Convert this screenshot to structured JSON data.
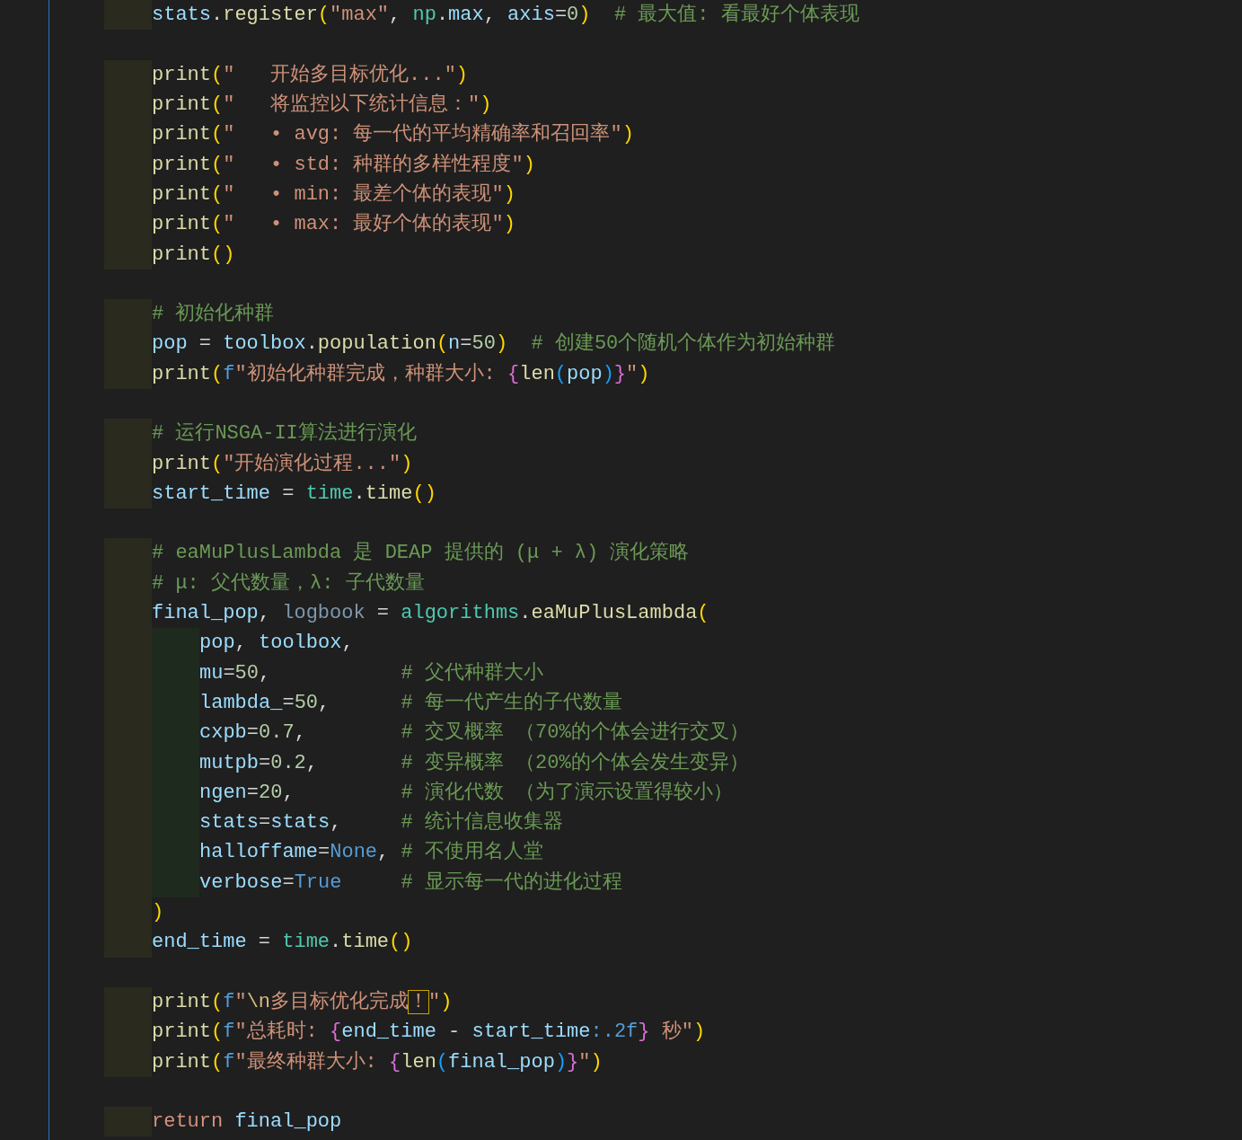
{
  "editor": {
    "lines": [
      {
        "kind": "code",
        "tokens": [
          {
            "kind": "var",
            "text": "stats"
          },
          {
            "kind": "plain",
            "text": "."
          },
          {
            "kind": "func",
            "text": "register"
          },
          {
            "kind": "bracket1",
            "text": "("
          },
          {
            "kind": "string",
            "text": "\"max\""
          },
          {
            "kind": "plain",
            "text": ", "
          },
          {
            "kind": "module",
            "text": "np"
          },
          {
            "kind": "plain",
            "text": "."
          },
          {
            "kind": "var",
            "text": "max"
          },
          {
            "kind": "plain",
            "text": ", "
          },
          {
            "kind": "var",
            "text": "axis"
          },
          {
            "kind": "plain",
            "text": "="
          },
          {
            "kind": "number",
            "text": "0"
          },
          {
            "kind": "bracket1",
            "text": ")"
          },
          {
            "kind": "comment",
            "text": "  # 最大值: 看最好个体表现"
          }
        ]
      },
      {
        "kind": "blank"
      },
      {
        "kind": "code",
        "tokens": [
          {
            "kind": "func",
            "text": "print"
          },
          {
            "kind": "bracket1",
            "text": "("
          },
          {
            "kind": "string",
            "text": "\"   开始多目标优化...\""
          },
          {
            "kind": "bracket1",
            "text": ")"
          }
        ]
      },
      {
        "kind": "code",
        "tokens": [
          {
            "kind": "func",
            "text": "print"
          },
          {
            "kind": "bracket1",
            "text": "("
          },
          {
            "kind": "string",
            "text": "\"   将监控以下统计信息：\""
          },
          {
            "kind": "bracket1",
            "text": ")"
          }
        ]
      },
      {
        "kind": "code",
        "tokens": [
          {
            "kind": "func",
            "text": "print"
          },
          {
            "kind": "bracket1",
            "text": "("
          },
          {
            "kind": "string",
            "text": "\"   • avg: 每一代的平均精确率和召回率\""
          },
          {
            "kind": "bracket1",
            "text": ")"
          }
        ]
      },
      {
        "kind": "code",
        "tokens": [
          {
            "kind": "func",
            "text": "print"
          },
          {
            "kind": "bracket1",
            "text": "("
          },
          {
            "kind": "string",
            "text": "\"   • std: 种群的多样性程度\""
          },
          {
            "kind": "bracket1",
            "text": ")"
          }
        ]
      },
      {
        "kind": "code",
        "tokens": [
          {
            "kind": "func",
            "text": "print"
          },
          {
            "kind": "bracket1",
            "text": "("
          },
          {
            "kind": "string",
            "text": "\"   • min: 最差个体的表现\""
          },
          {
            "kind": "bracket1",
            "text": ")"
          }
        ]
      },
      {
        "kind": "code",
        "tokens": [
          {
            "kind": "func",
            "text": "print"
          },
          {
            "kind": "bracket1",
            "text": "("
          },
          {
            "kind": "string",
            "text": "\"   • max: 最好个体的表现\""
          },
          {
            "kind": "bracket1",
            "text": ")"
          }
        ]
      },
      {
        "kind": "code",
        "tokens": [
          {
            "kind": "func",
            "text": "print"
          },
          {
            "kind": "bracket1",
            "text": "("
          },
          {
            "kind": "bracket1",
            "text": ")"
          }
        ]
      },
      {
        "kind": "blank"
      },
      {
        "kind": "code",
        "tokens": [
          {
            "kind": "comment",
            "text": "# 初始化种群"
          }
        ]
      },
      {
        "kind": "code",
        "tokens": [
          {
            "kind": "var",
            "text": "pop"
          },
          {
            "kind": "plain",
            "text": " = "
          },
          {
            "kind": "var",
            "text": "toolbox"
          },
          {
            "kind": "plain",
            "text": "."
          },
          {
            "kind": "func",
            "text": "population"
          },
          {
            "kind": "bracket1",
            "text": "("
          },
          {
            "kind": "var",
            "text": "n"
          },
          {
            "kind": "plain",
            "text": "="
          },
          {
            "kind": "number",
            "text": "50"
          },
          {
            "kind": "bracket1",
            "text": ")"
          },
          {
            "kind": "comment",
            "text": "  # 创建50个随机个体作为初始种群"
          }
        ]
      },
      {
        "kind": "code",
        "tokens": [
          {
            "kind": "func",
            "text": "print"
          },
          {
            "kind": "bracket1",
            "text": "("
          },
          {
            "kind": "keyword",
            "text": "f"
          },
          {
            "kind": "string",
            "text": "\"初始化种群完成，种群大小: "
          },
          {
            "kind": "bracket2",
            "text": "{"
          },
          {
            "kind": "func",
            "text": "len"
          },
          {
            "kind": "bracket3",
            "text": "("
          },
          {
            "kind": "var",
            "text": "pop"
          },
          {
            "kind": "bracket3",
            "text": ")"
          },
          {
            "kind": "bracket2",
            "text": "}"
          },
          {
            "kind": "string",
            "text": "\""
          },
          {
            "kind": "bracket1",
            "text": ")"
          }
        ]
      },
      {
        "kind": "blank"
      },
      {
        "kind": "code",
        "tokens": [
          {
            "kind": "comment",
            "text": "# 运行NSGA-II算法进行演化"
          }
        ]
      },
      {
        "kind": "code",
        "tokens": [
          {
            "kind": "func",
            "text": "print"
          },
          {
            "kind": "bracket1",
            "text": "("
          },
          {
            "kind": "string",
            "text": "\"开始演化过程...\""
          },
          {
            "kind": "bracket1",
            "text": ")"
          }
        ]
      },
      {
        "kind": "code",
        "tokens": [
          {
            "kind": "var",
            "text": "start_time"
          },
          {
            "kind": "plain",
            "text": " = "
          },
          {
            "kind": "module",
            "text": "time"
          },
          {
            "kind": "plain",
            "text": "."
          },
          {
            "kind": "func",
            "text": "time"
          },
          {
            "kind": "bracket1",
            "text": "("
          },
          {
            "kind": "bracket1",
            "text": ")"
          }
        ]
      },
      {
        "kind": "blank"
      },
      {
        "kind": "code",
        "tokens": [
          {
            "kind": "comment",
            "text": "# eaMuPlusLambda 是 DEAP 提供的 (μ + λ) 演化策略"
          }
        ]
      },
      {
        "kind": "code",
        "tokens": [
          {
            "kind": "comment",
            "text": "# μ: 父代数量，λ: 子代数量"
          }
        ]
      },
      {
        "kind": "code",
        "tokens": [
          {
            "kind": "var",
            "text": "final_pop"
          },
          {
            "kind": "plain",
            "text": ", "
          },
          {
            "kind": "unused",
            "text": "logbook"
          },
          {
            "kind": "plain",
            "text": " = "
          },
          {
            "kind": "module",
            "text": "algorithms"
          },
          {
            "kind": "plain",
            "text": "."
          },
          {
            "kind": "func",
            "text": "eaMuPlusLambda"
          },
          {
            "kind": "bracket1",
            "text": "("
          }
        ],
        "children": [
          {
            "kind": "code",
            "tokens": [
              {
                "kind": "var",
                "text": "pop"
              },
              {
                "kind": "plain",
                "text": ", "
              },
              {
                "kind": "var",
                "text": "toolbox"
              },
              {
                "kind": "plain",
                "text": ","
              }
            ]
          },
          {
            "kind": "code",
            "tokens": [
              {
                "kind": "var",
                "text": "mu"
              },
              {
                "kind": "plain",
                "text": "="
              },
              {
                "kind": "number",
                "text": "50"
              },
              {
                "kind": "plain",
                "text": ",           "
              },
              {
                "kind": "comment",
                "text": "# 父代种群大小"
              }
            ]
          },
          {
            "kind": "code",
            "tokens": [
              {
                "kind": "var",
                "text": "lambda_"
              },
              {
                "kind": "plain",
                "text": "="
              },
              {
                "kind": "number",
                "text": "50"
              },
              {
                "kind": "plain",
                "text": ",      "
              },
              {
                "kind": "comment",
                "text": "# 每一代产生的子代数量"
              }
            ]
          },
          {
            "kind": "code",
            "tokens": [
              {
                "kind": "var",
                "text": "cxpb"
              },
              {
                "kind": "plain",
                "text": "="
              },
              {
                "kind": "number",
                "text": "0.7"
              },
              {
                "kind": "plain",
                "text": ",        "
              },
              {
                "kind": "comment",
                "text": "# 交叉概率 （70%的个体会进行交叉）"
              }
            ]
          },
          {
            "kind": "code",
            "tokens": [
              {
                "kind": "var",
                "text": "mutpb"
              },
              {
                "kind": "plain",
                "text": "="
              },
              {
                "kind": "number",
                "text": "0.2"
              },
              {
                "kind": "plain",
                "text": ",       "
              },
              {
                "kind": "comment",
                "text": "# 变异概率 （20%的个体会发生变异）"
              }
            ]
          },
          {
            "kind": "code",
            "tokens": [
              {
                "kind": "var",
                "text": "ngen"
              },
              {
                "kind": "plain",
                "text": "="
              },
              {
                "kind": "number",
                "text": "20"
              },
              {
                "kind": "plain",
                "text": ",         "
              },
              {
                "kind": "comment",
                "text": "# 演化代数 （为了演示设置得较小）"
              }
            ]
          },
          {
            "kind": "code",
            "tokens": [
              {
                "kind": "var",
                "text": "stats"
              },
              {
                "kind": "plain",
                "text": "="
              },
              {
                "kind": "var",
                "text": "stats"
              },
              {
                "kind": "plain",
                "text": ",     "
              },
              {
                "kind": "comment",
                "text": "# 统计信息收集器"
              }
            ]
          },
          {
            "kind": "code",
            "tokens": [
              {
                "kind": "var",
                "text": "halloffame"
              },
              {
                "kind": "plain",
                "text": "="
              },
              {
                "kind": "keyword",
                "text": "None"
              },
              {
                "kind": "plain",
                "text": ", "
              },
              {
                "kind": "comment",
                "text": "# 不使用名人堂"
              }
            ]
          },
          {
            "kind": "code",
            "tokens": [
              {
                "kind": "var",
                "text": "verbose"
              },
              {
                "kind": "plain",
                "text": "="
              },
              {
                "kind": "keyword",
                "text": "True"
              },
              {
                "kind": "comment",
                "text": "     # 显示每一代的进化过程"
              }
            ]
          }
        ]
      },
      {
        "kind": "code",
        "tokens": [
          {
            "kind": "bracket1",
            "text": ")"
          }
        ]
      },
      {
        "kind": "code",
        "tokens": [
          {
            "kind": "var",
            "text": "end_time"
          },
          {
            "kind": "plain",
            "text": " = "
          },
          {
            "kind": "module",
            "text": "time"
          },
          {
            "kind": "plain",
            "text": "."
          },
          {
            "kind": "func",
            "text": "time"
          },
          {
            "kind": "bracket1",
            "text": "("
          },
          {
            "kind": "bracket1",
            "text": ")"
          }
        ]
      },
      {
        "kind": "blank"
      },
      {
        "kind": "code",
        "tokens": [
          {
            "kind": "func",
            "text": "print"
          },
          {
            "kind": "bracket1",
            "text": "("
          },
          {
            "kind": "keyword",
            "text": "f"
          },
          {
            "kind": "string",
            "text": "\""
          },
          {
            "kind": "escape",
            "text": "\\n"
          },
          {
            "kind": "string",
            "text": "多目标优化完成"
          },
          {
            "kind": "string",
            "text": "！",
            "boxed": true
          },
          {
            "kind": "string",
            "text": "\""
          },
          {
            "kind": "bracket1",
            "text": ")"
          }
        ]
      },
      {
        "kind": "code",
        "tokens": [
          {
            "kind": "func",
            "text": "print"
          },
          {
            "kind": "bracket1",
            "text": "("
          },
          {
            "kind": "keyword",
            "text": "f"
          },
          {
            "kind": "string",
            "text": "\"总耗时: "
          },
          {
            "kind": "bracket2",
            "text": "{"
          },
          {
            "kind": "var",
            "text": "end_time"
          },
          {
            "kind": "plain",
            "text": " - "
          },
          {
            "kind": "var",
            "text": "start_time"
          },
          {
            "kind": "keyword",
            "text": ":.2f"
          },
          {
            "kind": "bracket2",
            "text": "}"
          },
          {
            "kind": "string",
            "text": " 秒\""
          },
          {
            "kind": "bracket1",
            "text": ")"
          }
        ]
      },
      {
        "kind": "code",
        "tokens": [
          {
            "kind": "func",
            "text": "print"
          },
          {
            "kind": "bracket1",
            "text": "("
          },
          {
            "kind": "keyword",
            "text": "f"
          },
          {
            "kind": "string",
            "text": "\"最终种群大小: "
          },
          {
            "kind": "bracket2",
            "text": "{"
          },
          {
            "kind": "func",
            "text": "len"
          },
          {
            "kind": "bracket3",
            "text": "("
          },
          {
            "kind": "var",
            "text": "final_pop"
          },
          {
            "kind": "bracket3",
            "text": ")"
          },
          {
            "kind": "bracket2",
            "text": "}"
          },
          {
            "kind": "string",
            "text": "\""
          },
          {
            "kind": "bracket1",
            "text": ")"
          }
        ]
      },
      {
        "kind": "blank"
      },
      {
        "kind": "code",
        "tokens": [
          {
            "kind": "control",
            "text": "return "
          },
          {
            "kind": "var",
            "text": "final_pop"
          }
        ]
      }
    ]
  }
}
